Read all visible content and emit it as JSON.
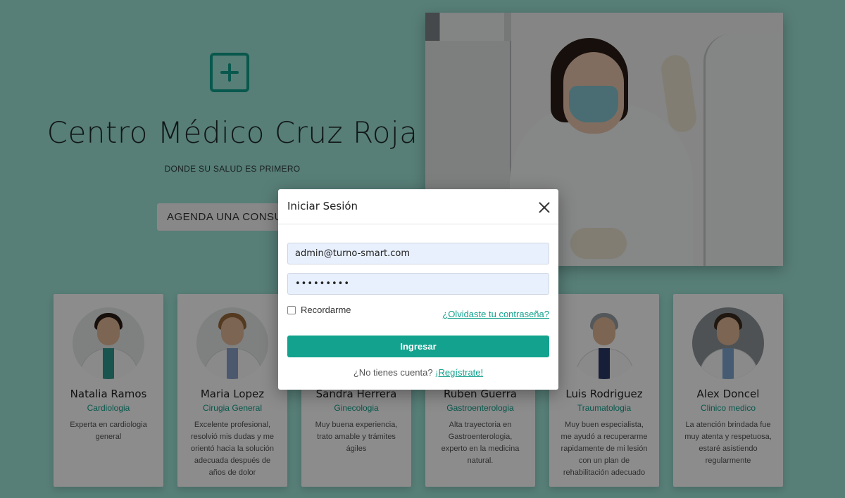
{
  "hero": {
    "title": "Centro Médico Cruz Roja",
    "subtitle": "DONDE SU SALUD ES PRIMERO",
    "cta_label": "AGENDA UNA CONSULTA",
    "logo_icon": "medical-plus-icon",
    "photo": "doctor-with-mask-photo"
  },
  "doctors": [
    {
      "name": "Natalia Ramos",
      "specialty": "Cardiologia",
      "review": "Experta en cardiologia general"
    },
    {
      "name": "Maria Lopez",
      "specialty": "Cirugia General",
      "review": "Excelente profesional, resolvió mis dudas y me orientó hacia la solución adecuada después de años de dolor"
    },
    {
      "name": "Sandra Herrera",
      "specialty": "Ginecologia",
      "review": "Muy buena experiencia, trato amable y trámites ágiles"
    },
    {
      "name": "Ruben Guerra",
      "specialty": "Gastroenterologia",
      "review": "Alta trayectoria en Gastroenterologia, experto en la medicina natural."
    },
    {
      "name": "Luis Rodriguez",
      "specialty": "Traumatologia",
      "review": "Muy buen especialista, me ayudó a recuperarme rapidamente de mi lesión con un plan de rehabilitación adecuado"
    },
    {
      "name": "Alex Doncel",
      "specialty": "Clinico medico",
      "review": "La atención brindada fue muy atenta y respetuosa, estaré asistiendo regularmente"
    }
  ],
  "login_modal": {
    "title": "Iniciar Sesión",
    "email_value": "admin@turno-smart.com",
    "password_value": "•••••••••",
    "remember_label": "Recordarme",
    "forgot_label": "¿Olvidaste tu contraseña?",
    "submit_label": "Ingresar",
    "signup_prompt": "¿No tienes cuenta?",
    "signup_link": "¡Regístrate!"
  },
  "colors": {
    "accent": "#10a08c",
    "background": "#9fe6d9",
    "input_bg": "#e8f0fe"
  }
}
